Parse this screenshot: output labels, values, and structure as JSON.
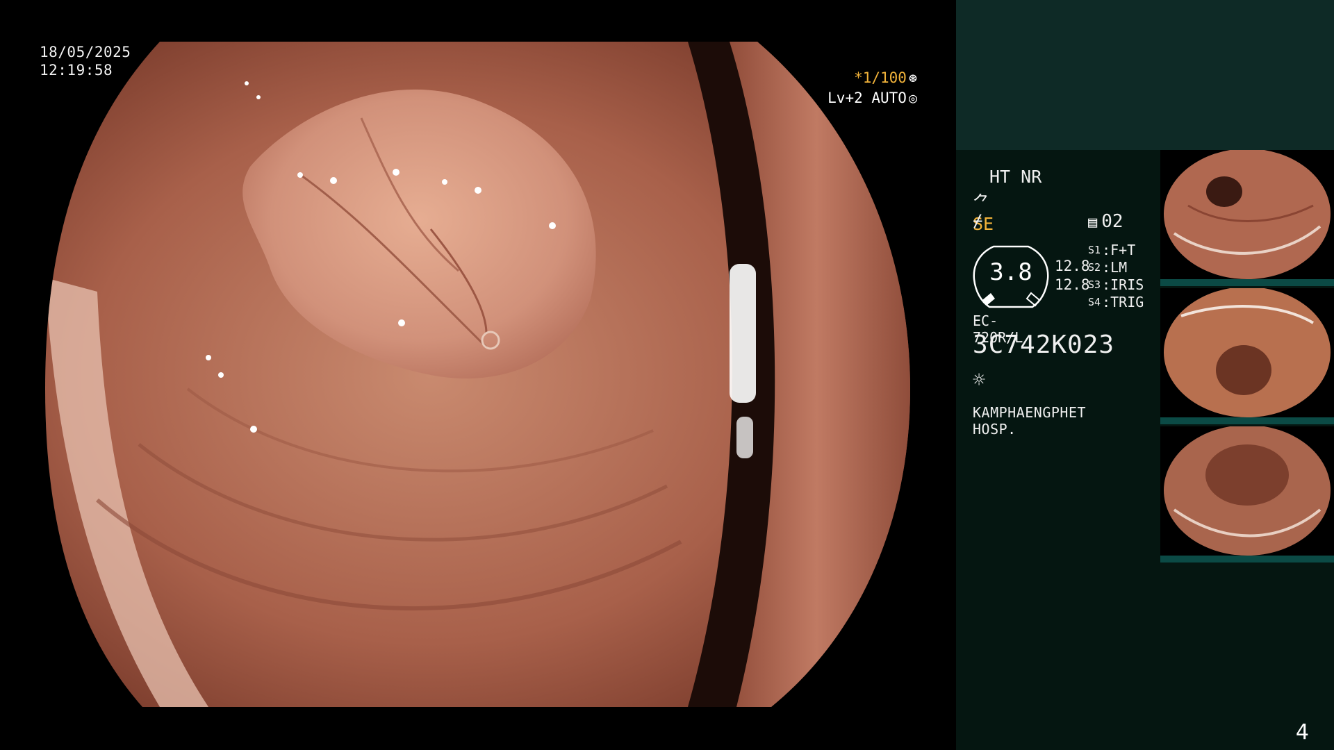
{
  "overlay": {
    "date": "18/05/2025",
    "time": "12:19:58",
    "shutter": "*1/100",
    "shutter_icon": "⊛",
    "level_auto": "Lv+2 AUTO",
    "level_icon": "◎"
  },
  "panel": {
    "mode_line": "HT NR",
    "se_prefix": "⺈",
    "se_label": "SE",
    "wave_icon": "⌿",
    "memo_count": "02",
    "gauge_value": "3.8",
    "gauge_side_1": "12.8",
    "gauge_side_2": "12.8",
    "switches": [
      {
        "key": "S1",
        "label": "F+T"
      },
      {
        "key": "S2",
        "label": "LM"
      },
      {
        "key": "S3",
        "label": "IRIS"
      },
      {
        "key": "S4",
        "label": "TRIG"
      }
    ],
    "scope_model": "EC-720R/L",
    "serial": "3C742K023",
    "light_icon": "☼",
    "hospital": "KAMPHAENGPHET HOSP."
  },
  "page_number": "4",
  "colors": {
    "panel_bg": "#051611",
    "panel_band": "#0e2a26",
    "accent_orange": "#f2b33a",
    "thumb_bar": "#0b4a45"
  }
}
